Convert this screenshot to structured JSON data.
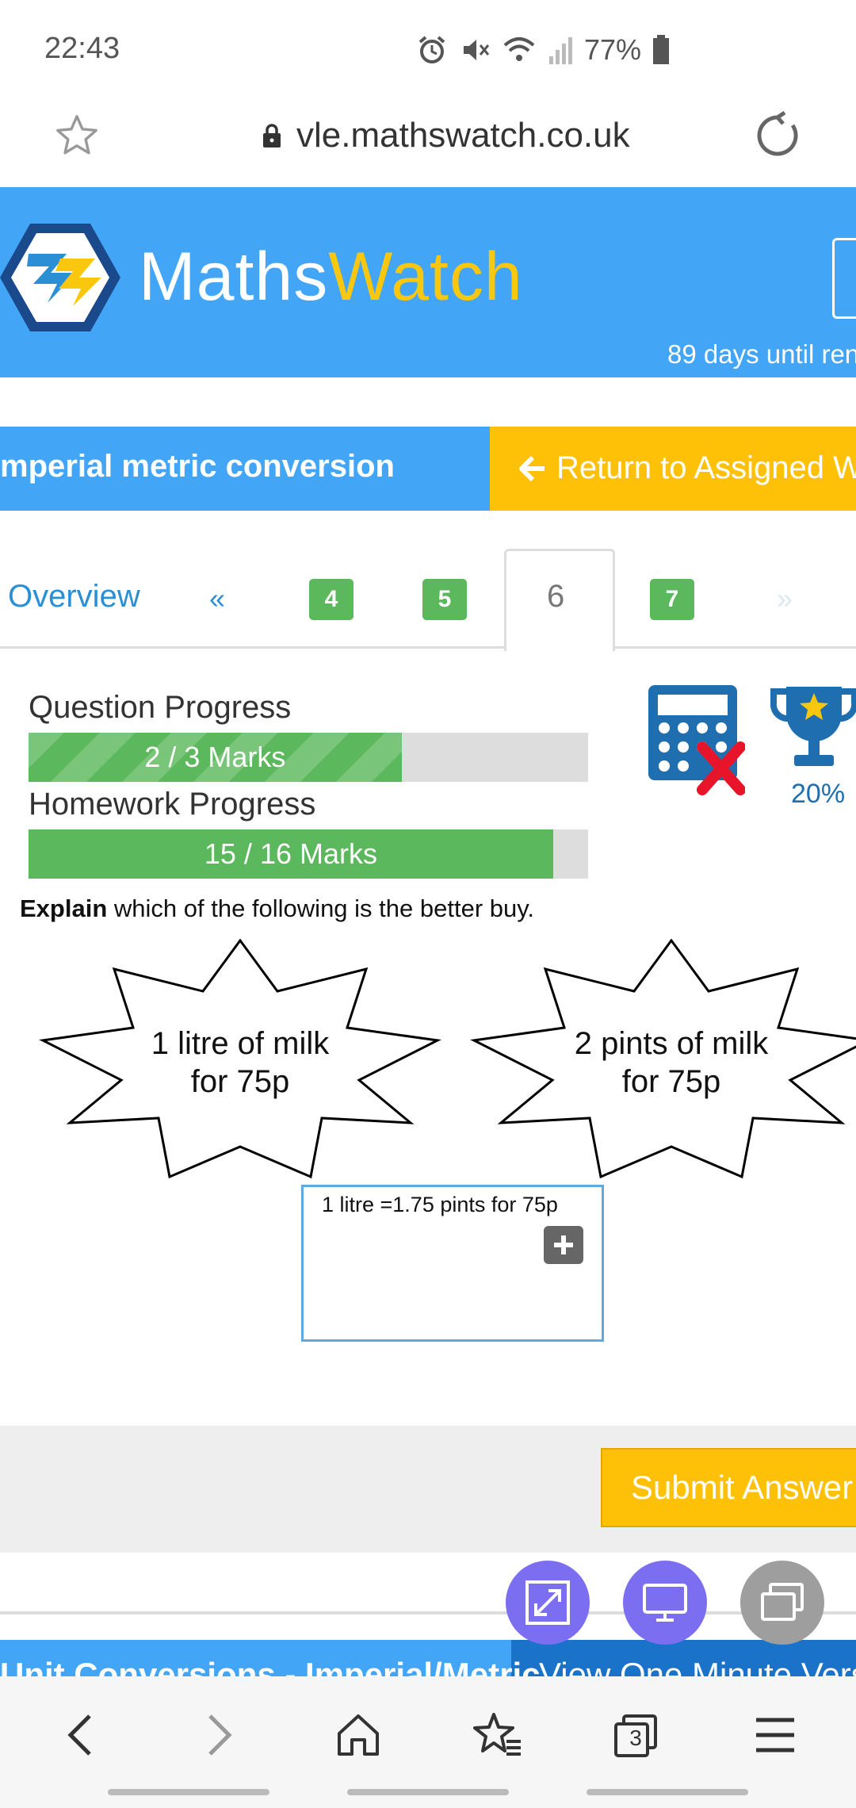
{
  "status_bar": {
    "time": "22:43",
    "battery": "77%",
    "icons": [
      "alarm-icon",
      "mute-icon",
      "wifi-icon",
      "signal-icon",
      "battery-icon"
    ]
  },
  "browser": {
    "url": "vle.mathswatch.co.uk",
    "tab_count": "3"
  },
  "header": {
    "brand_left": "Maths",
    "brand_right": "Watch",
    "days_text": "89 days until ren"
  },
  "title_bar": {
    "title": "mperial metric conversion",
    "return_label": "Return to Assigned W"
  },
  "tabs": {
    "overview": "Overview",
    "prev": "«",
    "items": [
      {
        "label": "4"
      },
      {
        "label": "5"
      },
      {
        "label": "6"
      },
      {
        "label": "7"
      }
    ],
    "next": "»"
  },
  "progress": {
    "question_label": "Question Progress",
    "question_text": "2 / 3 Marks",
    "question_fraction": 0.6667,
    "homework_label": "Homework Progress",
    "homework_text": "15 / 16 Marks",
    "homework_fraction": 0.9375,
    "trophy_percent": "20%"
  },
  "question": {
    "bold": "Explain",
    "rest": " which of the following is the better buy.",
    "option1_line1": "1 litre of milk",
    "option1_line2": "for 75p",
    "option2_line1": "2 pints of milk",
    "option2_line2": "for 75p"
  },
  "answer": {
    "text": "1 litre =1.75 pints for 75p"
  },
  "submit": {
    "label": "Submit Answer"
  },
  "banner": {
    "left": "Unit Conversions - Imperial/Metric",
    "right": "View One Minute Vers"
  },
  "colors": {
    "primary_blue": "#42a5f5",
    "accent_yellow": "#ffc107",
    "success_green": "#5cb85c",
    "fab_purple": "#7b6ef0"
  }
}
